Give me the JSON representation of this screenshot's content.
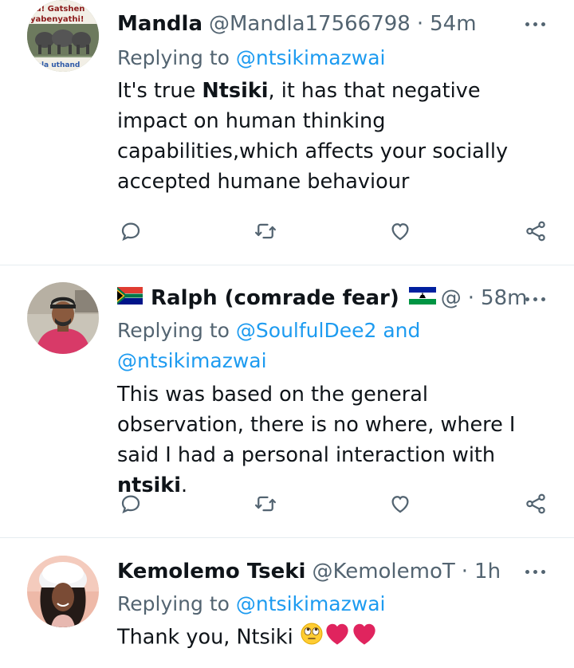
{
  "tweets": [
    {
      "name": "Mandla",
      "handle": "@Mandla17566798",
      "dot": "·",
      "time": "54m",
      "replying_prefix": "Replying to",
      "replying_to": "@ntsikimazwai",
      "body_start": "It's true",
      "body_bold": "Ntsiki",
      "body_end": ", it has that negative impact on human thinking capabilities,which affects your socially accepted humane behaviour",
      "avatar_text_top": "vu! Gatshen",
      "avatar_text_mid": "yabenyathi!",
      "avatar_text_bottom": "vela uthand"
    },
    {
      "name": "Ralph (comrade fear)",
      "handle": "@",
      "dot": "·",
      "time": "58m",
      "replying_prefix": "Replying to",
      "replying_to": "@SoulfulDee2 and",
      "replying_to_2": "@ntsikimazwai",
      "body_start": "This was based on the general observation, there is no where, where I said I had a personal interaction with",
      "body_bold": "ntsiki",
      "body_end": "."
    },
    {
      "name": "Kemolemo Tseki",
      "handle": "@KemolemoT",
      "dot": "·",
      "time": "1h",
      "replying_prefix": "Replying to",
      "replying_to": "@ntsikimazwai",
      "body_start": "Thank you, Ntsiki"
    }
  ],
  "icons": {
    "reply": "reply-icon",
    "retweet": "retweet-icon",
    "like": "heart-icon",
    "share": "share-icon",
    "more": "more-icon",
    "flag_za": "south-africa-flag-icon",
    "flag_ls": "lesotho-flag-icon",
    "emoji_eyeroll": "face-with-rolling-eyes-icon",
    "emoji_heart": "red-heart-icon"
  },
  "colors": {
    "text": "#0f1419",
    "secondary": "#536471",
    "link": "#1d9bf0",
    "divider": "#e6ecf0",
    "heart": "#e0245e"
  }
}
